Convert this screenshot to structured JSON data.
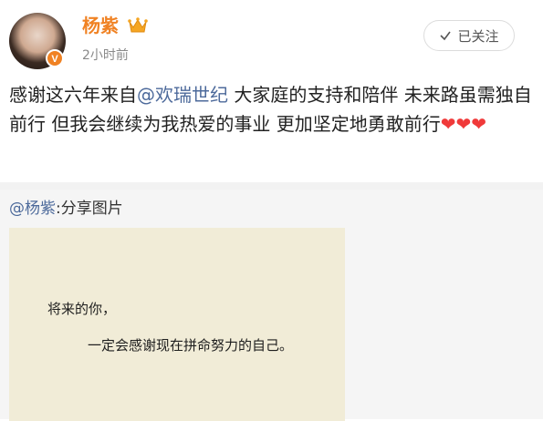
{
  "post": {
    "username": "杨紫",
    "timestamp": "2小时前",
    "follow_label": "已关注",
    "text_before": "感谢这六年来自",
    "mention": "@欢瑞世纪",
    "text_after": " 大家庭的支持和陪伴 未来路虽需独自前行 但我会继续为我热爱的事业 更加坚定地勇敢前行",
    "hearts": "❤❤❤"
  },
  "repost": {
    "author_mention": "@杨紫",
    "shared_label": ":分享图片",
    "image_text": {
      "line1": "将来的你，",
      "line2": "一定会感谢现在拼命努力的自己。"
    }
  },
  "colors": {
    "username": "#f08223",
    "mention": "#4d6a9b",
    "heart": "#f03a3a",
    "repost_background": "#f5f5f5",
    "image_background": "#f1ecd7"
  },
  "icons": {
    "verified": "verified-badge-icon",
    "crown": "crown-icon",
    "check": "check-icon"
  }
}
